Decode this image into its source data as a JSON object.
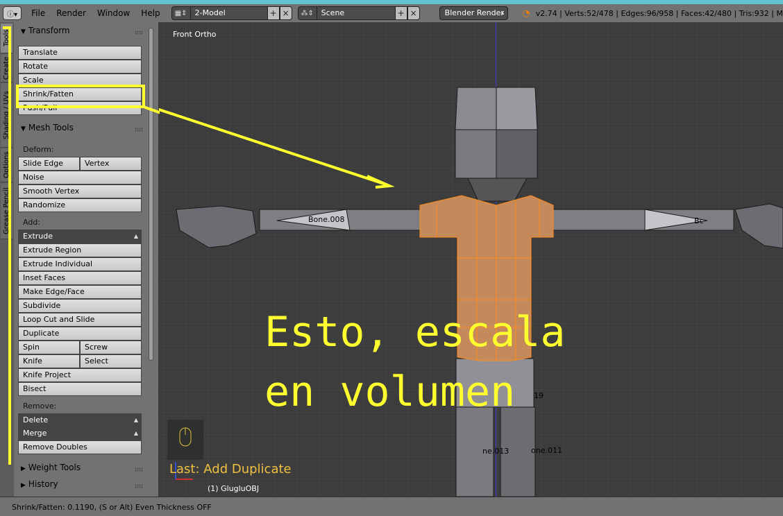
{
  "header": {
    "menu": [
      "File",
      "Render",
      "Window",
      "Help"
    ],
    "screen_layout": "2-Model",
    "scene": "Scene",
    "render_engine": "Blender Render",
    "stats": "v2.74 | Verts:52/478 | Edges:96/958 | Faces:42/480 | Tris:932 | M"
  },
  "tabs": [
    "Tools",
    "Create",
    "Shading / UVs",
    "Options",
    "Grease Pencil"
  ],
  "toolshelf": {
    "transform": {
      "title": "Transform",
      "buttons": [
        "Translate",
        "Rotate",
        "Scale",
        "Shrink/Fatten",
        "Push/Pull"
      ]
    },
    "mesh_tools": {
      "title": "Mesh Tools",
      "deform_label": "Deform:",
      "slide_edge": "Slide Edge",
      "vertex": "Vertex",
      "noise": "Noise",
      "smooth_vertex": "Smooth Vertex",
      "randomize": "Randomize",
      "add_label": "Add:",
      "extrude": "Extrude",
      "extrude_region": "Extrude Region",
      "extrude_individual": "Extrude Individual",
      "inset_faces": "Inset Faces",
      "make_edge_face": "Make Edge/Face",
      "subdivide": "Subdivide",
      "loop_cut": "Loop Cut and Slide",
      "duplicate": "Duplicate",
      "spin": "Spin",
      "screw": "Screw",
      "knife": "Knife",
      "select": "Select",
      "knife_project": "Knife Project",
      "bisect": "Bisect",
      "remove_label": "Remove:",
      "delete": "Delete",
      "merge": "Merge",
      "remove_doubles": "Remove Doubles"
    },
    "weight_tools": "Weight Tools",
    "history": "History"
  },
  "viewport": {
    "view_label": "Front Ortho",
    "bone_left": "Bone.008",
    "bone_right": "Bc",
    "bone_mid": "19",
    "bone_leg_left": "ne.013",
    "bone_leg_right": "one.011",
    "last_operator": "Last: Add Duplicate",
    "object_name": "(1) GlugluOBJ",
    "overlay_line1": "Esto, escala",
    "overlay_line2": "en volumen"
  },
  "status": "Shrink/Fatten: 0.1190, (S or Alt) Even Thickness OFF",
  "colors": {
    "annotation": "#ffff30",
    "selection": "#ff8c1a",
    "header_bg": "#727272",
    "viewport_bg": "#3d3d3d"
  }
}
